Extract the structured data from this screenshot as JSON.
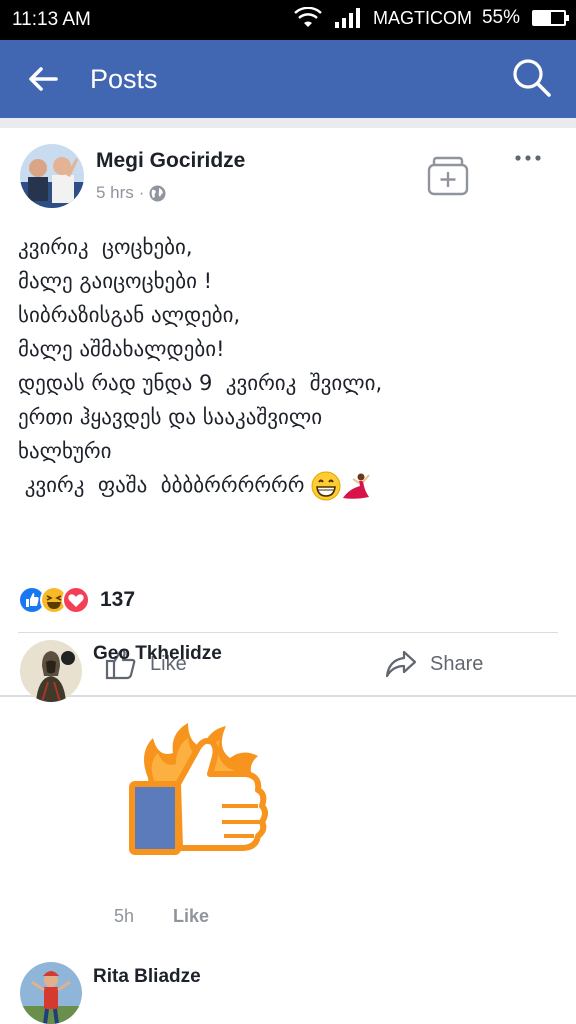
{
  "status_bar": {
    "time": "11:13 AM",
    "carrier": "MAGTICOM",
    "battery": "55%",
    "battery_level": 0.55,
    "icons": [
      "wifi-icon",
      "signal-icon",
      "battery-icon"
    ]
  },
  "app_bar": {
    "title": "Posts",
    "back_icon": "arrow-left-icon",
    "search_icon": "search-icon",
    "color": "#4267b2"
  },
  "post": {
    "author": "Megi Gociridze",
    "time": "5 hrs",
    "privacy_icon": "globe-icon",
    "text": "კვირიკ  ცოცხები,\nმალე გაიცოცხები !\nსიბრაზისგან ალდები,\nმალე აშმახალდები!\nდედას რად უნდა 9  კვირიკ  შვილი,\nერთი ჰყავდეს და სააკაშვილი\nხალხური\n კვირკ  ფაშა  ბბბბრრრრრრ",
    "emojis": [
      "grinning-face-icon",
      "dancer-icon"
    ],
    "actions": {
      "like": "Like",
      "share": "Share"
    },
    "reactions": {
      "types": [
        "like-reaction-icon",
        "haha-reaction-icon",
        "love-reaction-icon"
      ],
      "count": "137"
    }
  },
  "comments": [
    {
      "author": "Geo Tkhelidze",
      "content": "thumbs-up-sticker",
      "time": "5h",
      "like_label": "Like"
    },
    {
      "author": "Rita Bliadze"
    }
  ],
  "colors": {
    "facebook_blue": "#4267b2",
    "text": "#1d2129",
    "secondary_text": "#90949c"
  }
}
